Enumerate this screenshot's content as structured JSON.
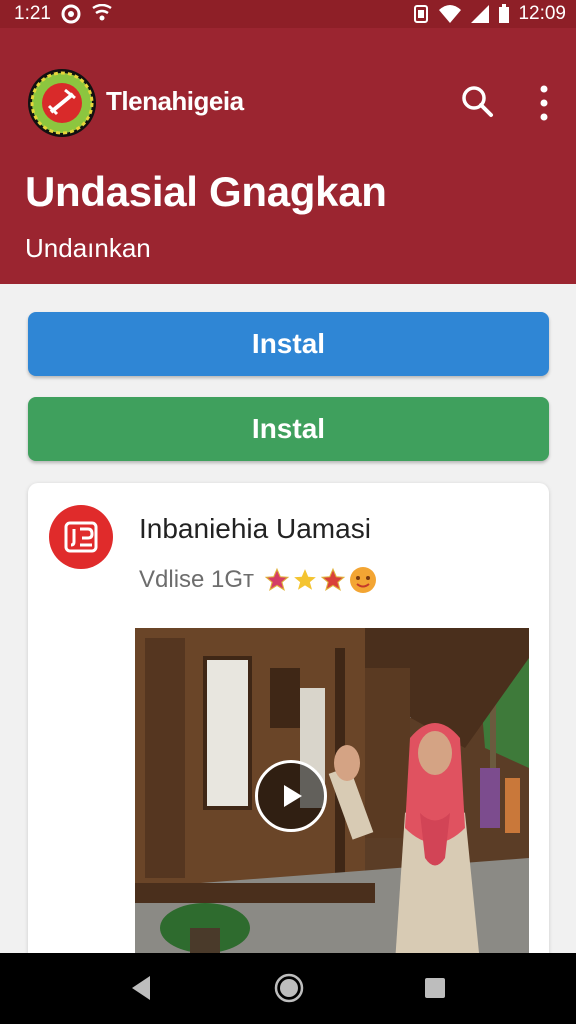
{
  "status_bar": {
    "time_left": "1:21",
    "time_right": "12:09"
  },
  "header": {
    "app_name": "Tlenahigeia",
    "headline": "Undasial Gnagkan",
    "subheadline": "Undaınkan",
    "colors": {
      "background": "#9b2530",
      "status_bar": "#8e1f27"
    }
  },
  "buttons": {
    "primary_label": "Instal",
    "secondary_label": "Instal",
    "colors": {
      "primary": "#2f86d5",
      "secondary": "#3fa05d"
    }
  },
  "card": {
    "icon": "document-icon",
    "title": "Inbaniehia Uamasi",
    "meta": "Vdlise 1Gт",
    "media": {
      "type": "video",
      "play_icon": "play-icon"
    }
  },
  "navigation": {
    "back_icon": "back-icon",
    "home_icon": "home-icon",
    "recent_icon": "recent-apps-icon"
  }
}
